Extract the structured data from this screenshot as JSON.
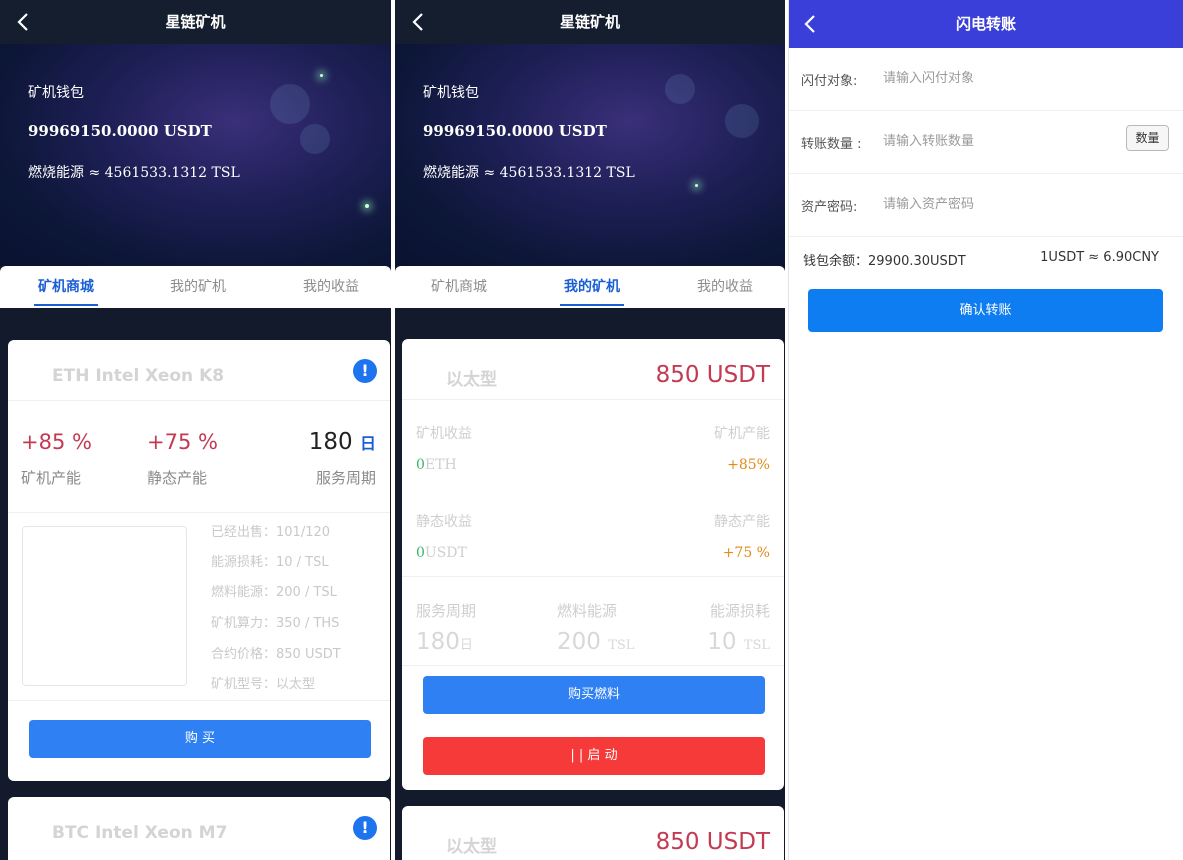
{
  "common": {
    "app_title": "星链矿机",
    "wallet_label": "矿机钱包",
    "balance": "99969150.0000 USDT",
    "burn_energy": "燃烧能源 ≈ 4561533.1312 TSL",
    "tabs": [
      "矿机商城",
      "我的矿机",
      "我的收益"
    ]
  },
  "shop": {
    "cards": [
      {
        "name": "ETH Intel Xeon K8",
        "info_icon": "!",
        "stats": [
          {
            "value": "+85 %",
            "label": "矿机产能"
          },
          {
            "value": "+75 %",
            "label": "静态产能"
          },
          {
            "value": "180",
            "unit": "日",
            "label": "服务周期"
          }
        ],
        "specs": [
          "已经出售：101/120",
          "能源损耗：10 / TSL",
          "燃料能源：200 / TSL",
          "矿机算力：350 / THS",
          "合约价格：850 USDT",
          "矿机型号：以太型"
        ],
        "buy_label": "购 买"
      },
      {
        "name": "BTC Intel Xeon M7",
        "info_icon": "!"
      }
    ]
  },
  "my_miners": {
    "cards": [
      {
        "type_name": "以太型",
        "price": "850 USDT",
        "miner_income_label": "矿机收益",
        "miner_capacity_label": "矿机产能",
        "miner_income_value": "0",
        "miner_income_unit": "ETH",
        "miner_capacity_value": "+85%",
        "static_income_label": "静态收益",
        "static_capacity_label": "静态产能",
        "static_income_value": "0",
        "static_income_unit": "USDT",
        "static_capacity_value": "+75 %",
        "bottom_stats": [
          {
            "label": "服务周期",
            "value": "180",
            "unit": "日"
          },
          {
            "label": "燃料能源",
            "value": "200",
            "unit": "TSL"
          },
          {
            "label": "能源损耗",
            "value": "10",
            "unit": "TSL"
          }
        ],
        "buy_fuel_label": "购买燃料",
        "start_label": "| | 启 动"
      },
      {
        "type_name": "以太型",
        "price": "850 USDT"
      }
    ]
  },
  "transfer": {
    "title": "闪电转账",
    "fields": [
      {
        "label": "闪付对象:",
        "placeholder": "请输入闪付对象"
      },
      {
        "label": "转账数量 :",
        "placeholder": "请输入转账数量"
      },
      {
        "label": "资产密码:",
        "placeholder": "请输入资产密码"
      }
    ],
    "qty_button": "数量",
    "wallet_balance": "钱包余额：29900.30USDT",
    "rate": "1USDT ≈ 6.90CNY",
    "confirm_label": "确认转账"
  },
  "colors": {
    "accent_blue": "#2f80f3",
    "tab_active": "#1a5fd6",
    "danger_red": "#f63a3a",
    "value_red": "#c43a52",
    "transfer_header": "#3b3fd9"
  }
}
